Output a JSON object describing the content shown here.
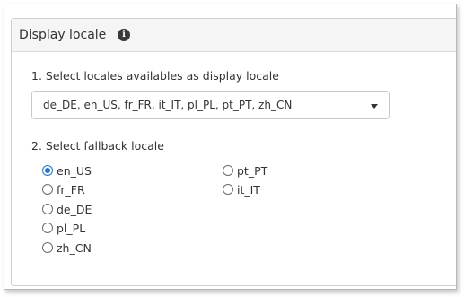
{
  "panel": {
    "title": "Display locale",
    "info_icon": "info-icon"
  },
  "display_locales": {
    "label": "1. Select locales availables as display locale",
    "selected_value": "de_DE, en_US, fr_FR, it_IT, pl_PL, pt_PT, zh_CN"
  },
  "fallback": {
    "label": "2. Select fallback locale",
    "selected": "en_US",
    "options": [
      "en_US",
      "fr_FR",
      "de_DE",
      "pl_PL",
      "zh_CN",
      "pt_PT",
      "it_IT"
    ]
  },
  "colors": {
    "accent": "#1a73e8",
    "heading_bg": "#f5f5f5",
    "text": "#333333"
  }
}
